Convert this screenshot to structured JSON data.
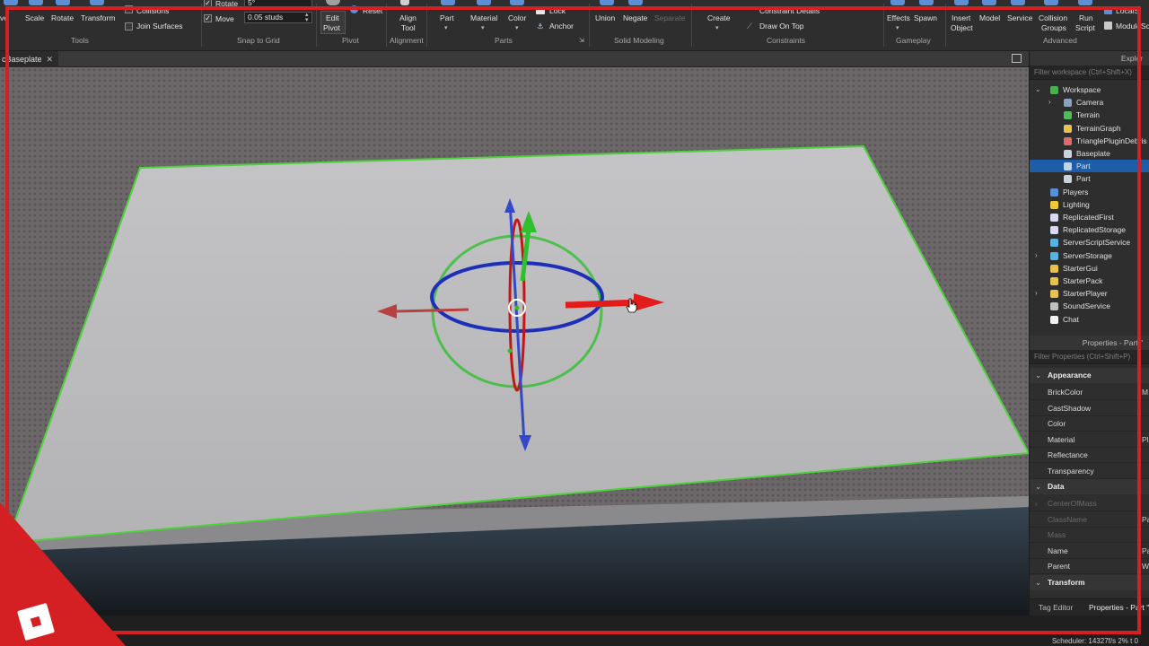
{
  "ribbon": {
    "tools": {
      "move_partial": "ve",
      "scale": "Scale",
      "rotate": "Rotate",
      "transform": "Transform",
      "group": "Tools"
    },
    "collisions": {
      "collisions": "Collisions",
      "join_surfaces": "Join Surfaces"
    },
    "snap": {
      "rotate_label": "Rotate",
      "rotate_value": "5°",
      "move_label": "Move",
      "move_value": "0.05 studs",
      "group": "Snap to Grid"
    },
    "pivot": {
      "edit_pivot_line1": "Edit",
      "edit_pivot_line2": "Pivot",
      "reset": "Reset",
      "group": "Pivot"
    },
    "alignment": {
      "align_tool_line1": "Align",
      "align_tool_line2": "Tool",
      "group": "Alignment"
    },
    "parts": {
      "part": "Part",
      "material": "Material",
      "color": "Color",
      "lock": "Lock",
      "anchor": "Anchor",
      "group": "Parts"
    },
    "solid_modeling": {
      "union": "Union",
      "negate": "Negate",
      "separate": "Separate",
      "group": "Solid Modeling"
    },
    "constraints": {
      "create": "Create",
      "constraint_details": "Constraint Details",
      "draw_on_top": "Draw On Top",
      "group": "Constraints"
    },
    "gameplay": {
      "effects": "Effects",
      "spawn": "Spawn",
      "group": "Gameplay"
    },
    "advanced": {
      "insert_object_line1": "Insert",
      "insert_object_line2": "Object",
      "model": "Model",
      "service": "Service",
      "collision_groups_line1": "Collision",
      "collision_groups_line2": "Groups",
      "run_script_line1": "Run",
      "run_script_line2": "Script",
      "local_script": "LocalS",
      "module_script": "ModuleSc",
      "group": "Advanced"
    }
  },
  "tabs": {
    "document_tab": "cBaseplate",
    "close_glyph": "✕"
  },
  "explorer": {
    "title": "Explor",
    "filter_placeholder": "Filter workspace (Ctrl+Shift+X)",
    "items": [
      {
        "label": "Workspace",
        "indent": 0,
        "expander": "expanded",
        "icon": "workspace-icon",
        "color": "#4caf50",
        "selected": false
      },
      {
        "label": "Camera",
        "indent": 1,
        "expander": "collapsed",
        "icon": "camera-icon",
        "color": "#8aa2c0",
        "selected": false
      },
      {
        "label": "Terrain",
        "indent": 1,
        "expander": "none",
        "icon": "terrain-icon",
        "color": "#4dbd5b",
        "selected": false
      },
      {
        "label": "TerrainGraph",
        "indent": 1,
        "expander": "none",
        "icon": "folder-icon",
        "color": "#e8c24a",
        "selected": false
      },
      {
        "label": "TrianglePluginDebris",
        "indent": 1,
        "expander": "none",
        "icon": "model-icon",
        "color": "#e06a6a",
        "selected": false
      },
      {
        "label": "Baseplate",
        "indent": 1,
        "expander": "none",
        "icon": "part-icon",
        "color": "#c9d3e0",
        "selected": false
      },
      {
        "label": "Part",
        "indent": 1,
        "expander": "none",
        "icon": "part-icon",
        "color": "#c9d3e0",
        "selected": true
      },
      {
        "label": "Part",
        "indent": 1,
        "expander": "none",
        "icon": "part-icon",
        "color": "#c9d3e0",
        "selected": false
      },
      {
        "label": "Players",
        "indent": 0,
        "expander": "none",
        "icon": "players-icon",
        "color": "#5a8fd8",
        "selected": false
      },
      {
        "label": "Lighting",
        "indent": 0,
        "expander": "none",
        "icon": "lighting-icon",
        "color": "#f0c93a",
        "selected": false
      },
      {
        "label": "ReplicatedFirst",
        "indent": 0,
        "expander": "none",
        "icon": "replicated-icon",
        "color": "#d8d8f0",
        "selected": false
      },
      {
        "label": "ReplicatedStorage",
        "indent": 0,
        "expander": "none",
        "icon": "replicated-icon",
        "color": "#d8d8f0",
        "selected": false
      },
      {
        "label": "ServerScriptService",
        "indent": 0,
        "expander": "none",
        "icon": "server-script-icon",
        "color": "#59b1e0",
        "selected": false
      },
      {
        "label": "ServerStorage",
        "indent": 0,
        "expander": "collapsed",
        "icon": "server-storage-icon",
        "color": "#59b1e0",
        "selected": false
      },
      {
        "label": "StarterGui",
        "indent": 0,
        "expander": "none",
        "icon": "folder-icon",
        "color": "#e8c24a",
        "selected": false
      },
      {
        "label": "StarterPack",
        "indent": 0,
        "expander": "none",
        "icon": "folder-icon",
        "color": "#e8c24a",
        "selected": false
      },
      {
        "label": "StarterPlayer",
        "indent": 0,
        "expander": "collapsed",
        "icon": "folder-icon",
        "color": "#e8c24a",
        "selected": false
      },
      {
        "label": "SoundService",
        "indent": 0,
        "expander": "none",
        "icon": "sound-icon",
        "color": "#c0c0c0",
        "selected": false
      },
      {
        "label": "Chat",
        "indent": 0,
        "expander": "none",
        "icon": "chat-icon",
        "color": "#f0f0f0",
        "selected": false
      }
    ]
  },
  "properties": {
    "title": "Properties - Part \"",
    "filter_placeholder": "Filter Properties (Ctrl+Shift+P)",
    "sections": [
      {
        "name": "Appearance",
        "rows": [
          {
            "label": "BrickColor",
            "value": "M",
            "dim": false,
            "expander": false
          },
          {
            "label": "CastShadow",
            "value": "",
            "dim": false,
            "expander": false
          },
          {
            "label": "Color",
            "value": "",
            "dim": false,
            "expander": false
          },
          {
            "label": "Material",
            "value": "Plas",
            "dim": false,
            "expander": false
          },
          {
            "label": "Reflectance",
            "value": "",
            "dim": false,
            "expander": false
          },
          {
            "label": "Transparency",
            "value": "",
            "dim": false,
            "expander": false
          }
        ]
      },
      {
        "name": "Data",
        "rows": [
          {
            "label": "CenterOfMass",
            "value": "",
            "dim": true,
            "expander": true
          },
          {
            "label": "ClassName",
            "value": "Pa",
            "dim": true,
            "expander": false
          },
          {
            "label": "Mass",
            "value": "",
            "dim": true,
            "expander": false
          },
          {
            "label": "Name",
            "value": "Part",
            "dim": false,
            "expander": false
          },
          {
            "label": "Parent",
            "value": "Wor",
            "dim": false,
            "expander": false
          }
        ]
      },
      {
        "name": "Transform",
        "rows": []
      }
    ]
  },
  "bottom_tabs": {
    "tag_editor": "Tag Editor",
    "properties": "Properties - Part \""
  },
  "status": {
    "text": "Scheduler: 14327f/s 2%   t 0"
  },
  "colors": {
    "selection": "#1e5ea8",
    "frame": "#d41f23",
    "axis_x": "#e02020",
    "axis_y": "#2fbf2f",
    "axis_z": "#2a3fd0"
  }
}
